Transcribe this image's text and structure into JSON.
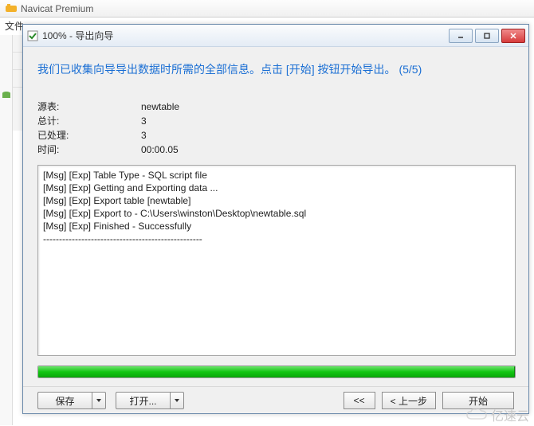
{
  "parent": {
    "title": "Navicat Premium",
    "menu_file": "文件"
  },
  "dialog": {
    "title": "100% - 导出向导",
    "heading": "我们已收集向导导出数据时所需的全部信息。点击 [开始] 按钮开始导出。  (5/5)",
    "info": {
      "source_label": "源表:",
      "source_value": "newtable",
      "total_label": "总计:",
      "total_value": "3",
      "processed_label": "已处理:",
      "processed_value": "3",
      "time_label": "时间:",
      "time_value": "00:00.05"
    },
    "log_lines": [
      "[Msg] [Exp] Table Type - SQL script file",
      "[Msg] [Exp] Getting and Exporting data ...",
      "[Msg] [Exp] Export table [newtable]",
      "[Msg] [Exp] Export to - C:\\Users\\winston\\Desktop\\newtable.sql",
      "[Msg] [Exp] Finished - Successfully",
      "--------------------------------------------------"
    ],
    "progress_percent": 100,
    "buttons": {
      "save": "保存",
      "open": "打开...",
      "back_first": "<<",
      "back": "< 上一步",
      "start": "开始"
    }
  },
  "watermark": "亿速云"
}
